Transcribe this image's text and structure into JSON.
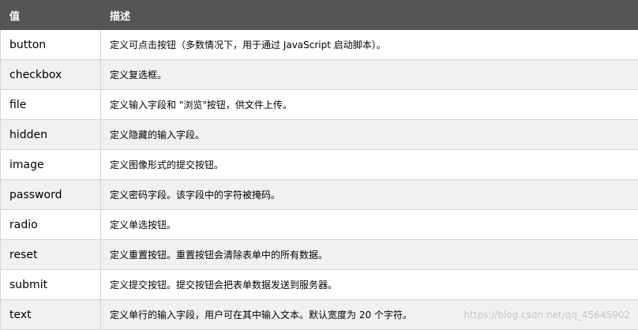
{
  "table": {
    "headers": {
      "value": "值",
      "description": "描述"
    },
    "rows": [
      {
        "value": "button",
        "description": "定义可点击按钮（多数情况下，用于通过 JavaScript 启动脚本）。"
      },
      {
        "value": "checkbox",
        "description": "定义复选框。"
      },
      {
        "value": "file",
        "description": "定义输入字段和 \"浏览\"按钮，供文件上传。"
      },
      {
        "value": "hidden",
        "description": "定义隐藏的输入字段。"
      },
      {
        "value": "image",
        "description": "定义图像形式的提交按钮。"
      },
      {
        "value": "password",
        "description": "定义密码字段。该字段中的字符被掩码。"
      },
      {
        "value": "radio",
        "description": "定义单选按钮。"
      },
      {
        "value": "reset",
        "description": "定义重置按钮。重置按钮会清除表单中的所有数据。"
      },
      {
        "value": "submit",
        "description": "定义提交按钮。提交按钮会把表单数据发送到服务器。"
      },
      {
        "value": "text",
        "description": "定义单行的输入字段，用户可在其中输入文本。默认宽度为 20 个字符。"
      }
    ]
  },
  "watermark": "https://blog.csdn.net/qq_45645902",
  "colors": {
    "header_bg": "#555555",
    "header_text": "#ffffff",
    "row_alt_bg": "#f1f1f1",
    "border": "#d4d4d4"
  }
}
